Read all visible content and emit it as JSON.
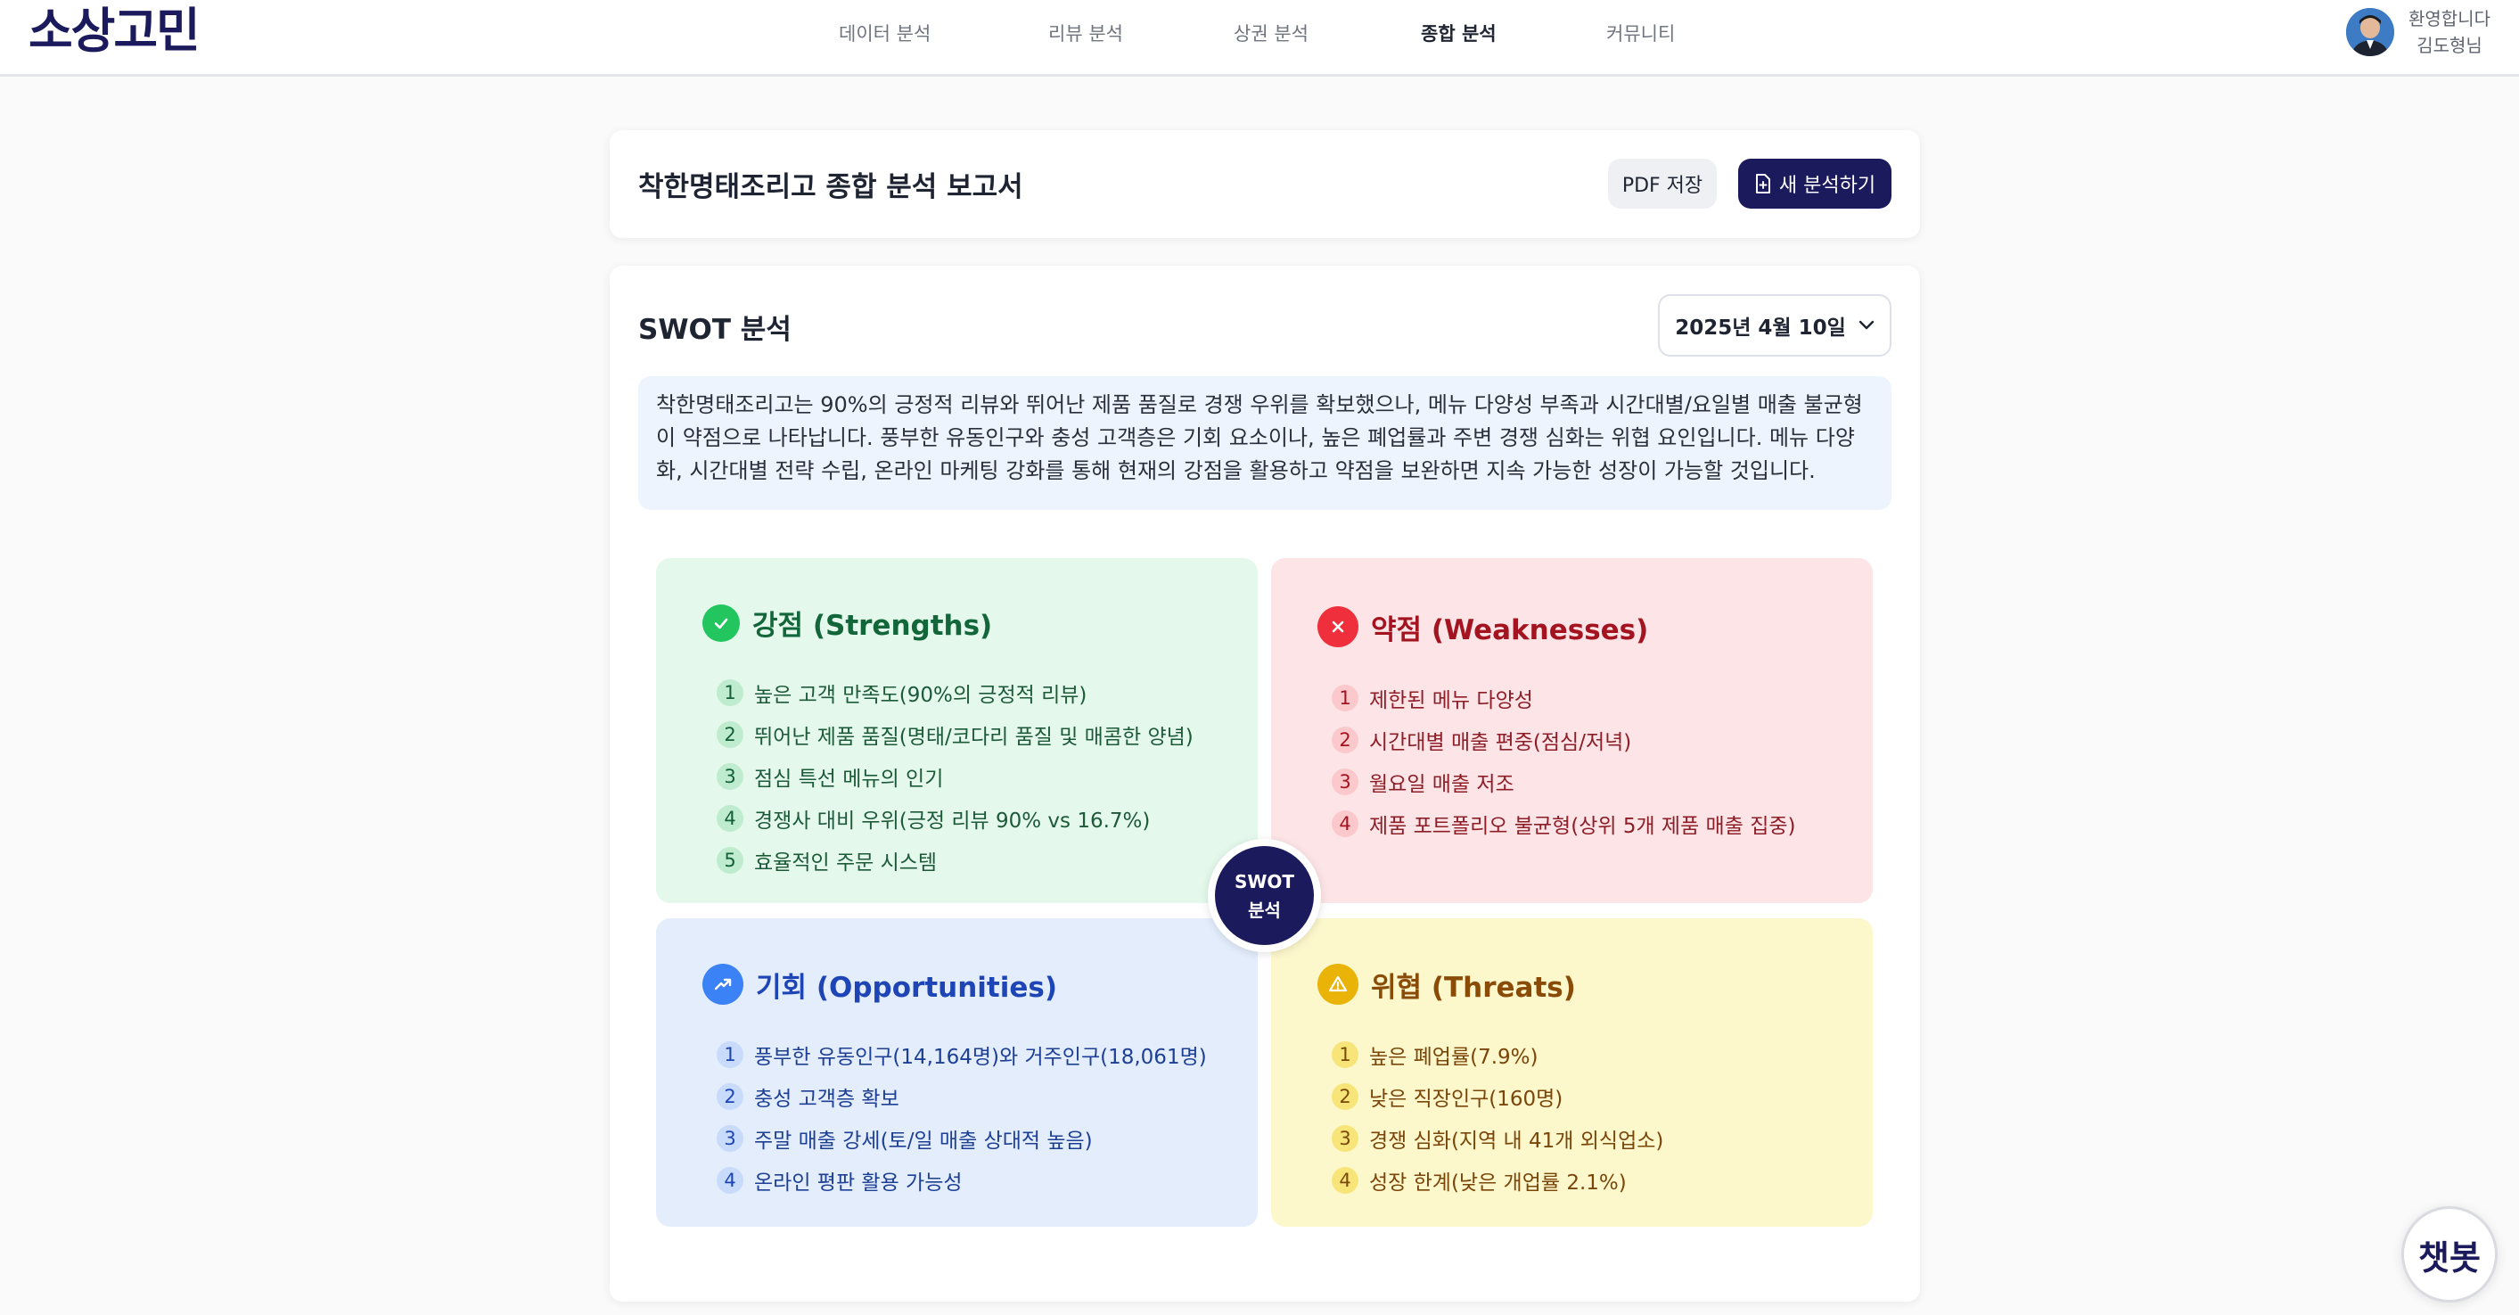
{
  "header": {
    "logo": "소상고민",
    "nav": [
      "데이터 분석",
      "리뷰 분석",
      "상권 분석",
      "종합 분석",
      "커뮤니티"
    ],
    "active_nav": "종합 분석",
    "user": {
      "greeting": "환영합니다",
      "name": "김도형님"
    }
  },
  "report": {
    "title": "착한명태조리고 종합 분석 보고서",
    "pdf_label": "PDF 저장",
    "new_label": "새 분석하기"
  },
  "swot": {
    "title": "SWOT 분석",
    "date": "2025년 4월 10일",
    "summary": "착한명태조리고는 90%의 긍정적 리뷰와 뛰어난 제품 품질로 경쟁 우위를 확보했으나, 메뉴 다양성 부족과 시간대별/요일별 매출 불균형이 약점으로 나타납니다. 풍부한 유동인구와 충성 고객층은 기회 요소이나, 높은 폐업률과 주변 경쟁 심화는 위협 요인입니다. 메뉴 다양화, 시간대별 전략 수립, 온라인 마케팅 강화를 통해 현재의 강점을 활용하고 약점을 보완하면 지속 가능한 성장이 가능할 것입니다.",
    "center_line1": "SWOT",
    "center_line2": "분석",
    "strengths": {
      "title": "강점 (Strengths)",
      "items": [
        "높은 고객 만족도(90%의 긍정적 리뷰)",
        "뛰어난 제품 품질(명태/코다리 품질 및 매콤한 양념)",
        "점심 특선 메뉴의 인기",
        "경쟁사 대비 우위(긍정 리뷰 90% vs 16.7%)",
        "효율적인 주문 시스템"
      ]
    },
    "weaknesses": {
      "title": "약점 (Weaknesses)",
      "items": [
        "제한된 메뉴 다양성",
        "시간대별 매출 편중(점심/저녁)",
        "월요일 매출 저조",
        "제품 포트폴리오 불균형(상위 5개 제품 매출 집중)"
      ]
    },
    "opportunities": {
      "title": "기회 (Opportunities)",
      "items": [
        "풍부한 유동인구(14,164명)와 거주인구(18,061명)",
        "충성 고객층 확보",
        "주말 매출 강세(토/일 매출 상대적 높음)",
        "온라인 평판 활용 가능성"
      ]
    },
    "threats": {
      "title": "위협 (Threats)",
      "items": [
        "높은 폐업률(7.9%)",
        "낮은 직장인구(160명)",
        "경쟁 심화(지역 내 41개 외식업소)",
        "성장 한계(낮은 개업률 2.1%)"
      ]
    }
  },
  "chatbot": {
    "label": "챗봇"
  },
  "colors": {
    "brand": "#1b1a5c",
    "strengths": "#22c55e",
    "weaknesses": "#ef2f3c",
    "opportunities": "#3b82f6",
    "threats": "#eab308"
  }
}
